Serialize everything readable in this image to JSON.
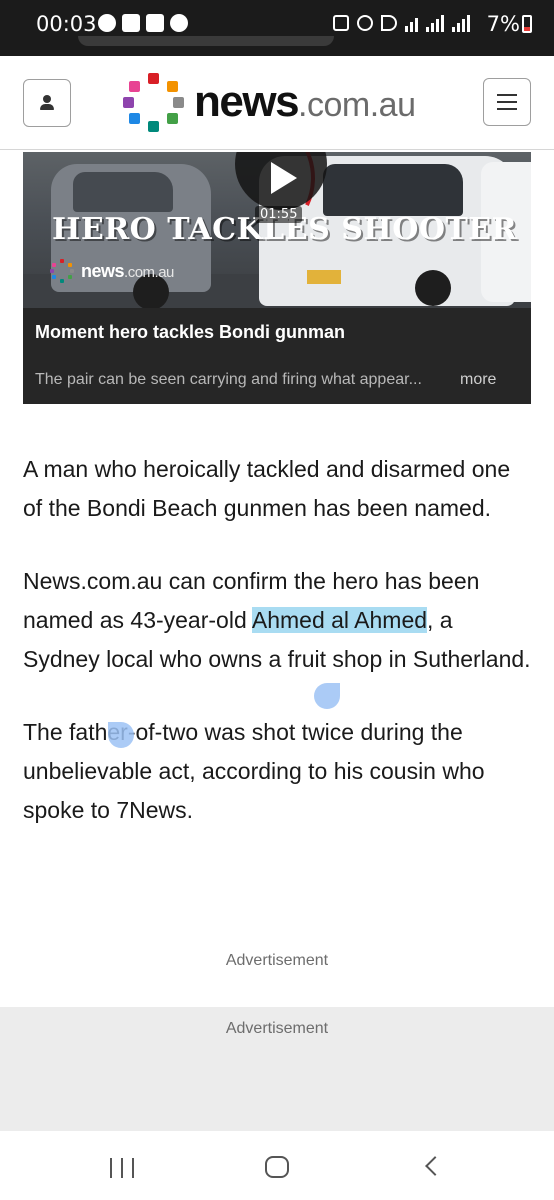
{
  "status_bar": {
    "time": "00:03",
    "battery": "7%"
  },
  "header": {
    "logo_text": "news",
    "logo_suffix": ".com.au"
  },
  "video": {
    "thumbnail_headline": "HERO TACKLES SHOOTER",
    "duration": "01:55",
    "watermark_text": "news",
    "watermark_suffix": ".com.au",
    "title": "Moment hero tackles Bondi gunman",
    "description": "The pair can be seen carrying and firing what appear...",
    "more_label": "more"
  },
  "article": {
    "p1": "A man who heroically tackled and disarmed one of the Bondi Beach gunmen has been named.",
    "p2_before": "News.com.au can confirm the hero has been named as 43-year-old ",
    "p2_highlight": "Ahmed al Ahmed",
    "p2_after": ", a Sydney local who owns a fruit shop in Sutherland.",
    "p3": "The father-of-two was shot twice during the unbelievable act, according to his cousin who spoke to 7News."
  },
  "ads": {
    "label_1": "Advertisement",
    "label_2": "Advertisement"
  },
  "colors": {
    "selection_highlight": "#a9dcf2",
    "selection_handle": "#9cc2f5",
    "logo_red": "#d81f26",
    "logo_orange": "#f39200",
    "logo_purple": "#8e44ad",
    "logo_grey": "#8a8a8a",
    "logo_blue": "#1e88e5",
    "logo_green": "#43a047",
    "logo_teal": "#00897b"
  }
}
